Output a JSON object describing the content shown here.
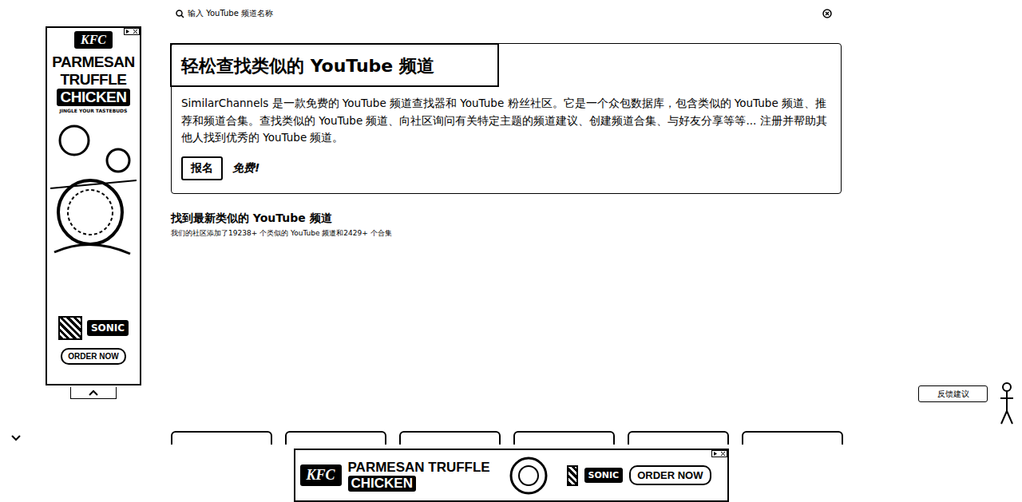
{
  "search": {
    "placeholder": "输入 YouTube 频道名称"
  },
  "hero": {
    "title": "轻松查找类似的 YouTube 频道",
    "description": "SimilarChannels 是一款免费的 YouTube 频道查找器和 YouTube 粉丝社区。它是一个众包数据库，包含类似的 YouTube 频道、推荐和频道合集。查找类似的 YouTube 频道、向社区询问有关特定主题的频道建议、创建频道合集、与好友分享等等... 注册并帮助其他人找到优秀的 YouTube 频道。",
    "signup_button": "报名",
    "free_label": "免费!"
  },
  "latest": {
    "heading": "找到最新类似的 YouTube 频道",
    "subtext": "我们的社区添加了19238+ 个类似的 YouTube 频道和2429+ 个合集"
  },
  "cards": [
    {},
    {},
    {},
    {},
    {},
    {}
  ],
  "side_ad": {
    "brand": "KFC",
    "lines": [
      "PARMESAN",
      "TRUFFLE",
      "CHICKEN"
    ],
    "tagline": "JINGLE YOUR TASTEBUDS",
    "badge": "SONIC",
    "cta": "ORDER NOW"
  },
  "bottom_ad": {
    "brand": "KFC",
    "lines": [
      "PARMESAN TRUFFLE",
      "CHICKEN"
    ],
    "badge": "SONIC",
    "cta": "ORDER NOW"
  },
  "feedback": {
    "label": "反馈建议"
  }
}
